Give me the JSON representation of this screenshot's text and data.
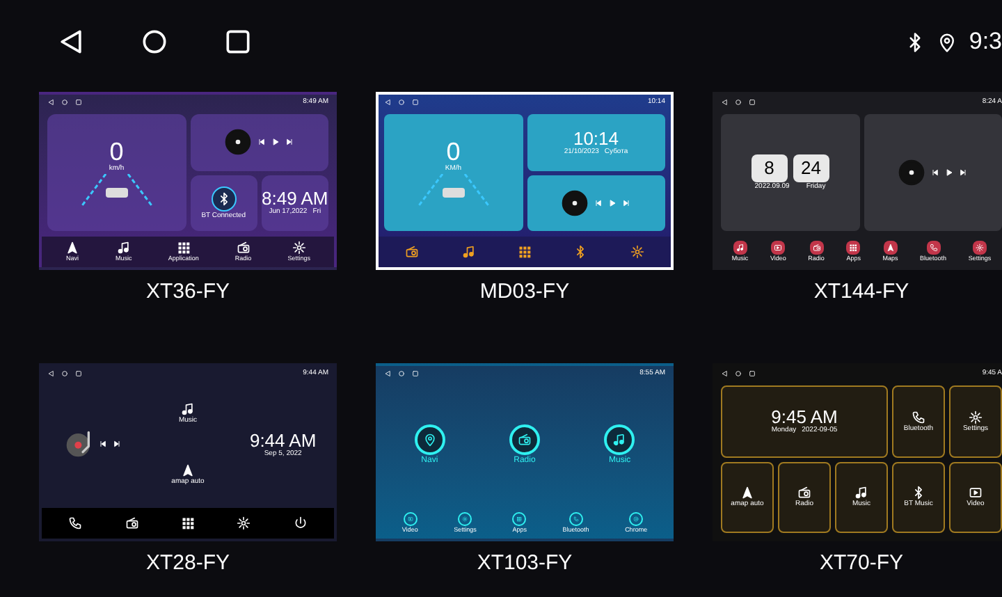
{
  "status_bar": {
    "time": "9:3"
  },
  "themes": [
    {
      "name": "XT36-FY",
      "selected": false,
      "status_time": "8:49 AM",
      "tiles": [
        {
          "kind": "speed",
          "texts": [
            "0",
            "km/h"
          ]
        },
        {
          "kind": "music"
        },
        {
          "kind": "bt",
          "texts": [
            "BT Connected"
          ]
        },
        {
          "kind": "clock",
          "texts": [
            "8:49 AM",
            "Jun 17,2022",
            "Fri"
          ]
        }
      ],
      "dock": [
        {
          "kind": "navigation",
          "label": "Navi"
        },
        {
          "kind": "music",
          "label": "Music"
        },
        {
          "kind": "apps",
          "label": "Application"
        },
        {
          "kind": "radio",
          "label": "Radio"
        },
        {
          "kind": "settings",
          "label": "Settings"
        }
      ]
    },
    {
      "name": "MD03-FY",
      "selected": true,
      "status_time": "10:14",
      "tiles": [
        {
          "kind": "speed",
          "texts": [
            "0",
            "KM/h"
          ]
        },
        {
          "kind": "clock",
          "texts": [
            "10:14",
            "21/10/2023",
            "Субота"
          ]
        },
        {
          "kind": "music"
        }
      ],
      "dock": [
        {
          "kind": "radio"
        },
        {
          "kind": "music"
        },
        {
          "kind": "apps"
        },
        {
          "kind": "bluetooth"
        },
        {
          "kind": "settings"
        }
      ]
    },
    {
      "name": "XT144-FY",
      "selected": false,
      "status_time": "8:24 A",
      "tiles": [
        {
          "kind": "flipclock",
          "texts": [
            "8",
            "24",
            "2022.09.09",
            "Friday"
          ]
        },
        {
          "kind": "music"
        }
      ],
      "dock": [
        {
          "kind": "music",
          "label": "Music"
        },
        {
          "kind": "video",
          "label": "Video"
        },
        {
          "kind": "radio",
          "label": "Radio"
        },
        {
          "kind": "apps",
          "label": "Apps"
        },
        {
          "kind": "navigation",
          "label": "Maps"
        },
        {
          "kind": "phone",
          "label": "Bluetooth"
        },
        {
          "kind": "settings",
          "label": "Settings"
        }
      ]
    },
    {
      "name": "XT28-FY",
      "selected": false,
      "status_time": "9:44 AM",
      "tiles": [
        {
          "kind": "player"
        },
        {
          "kind": "music_app",
          "texts": [
            "Music"
          ]
        },
        {
          "kind": "clock",
          "texts": [
            "9:44 AM",
            "Sep 5, 2022"
          ]
        },
        {
          "kind": "navigation_app",
          "texts": [
            "amap auto"
          ]
        }
      ],
      "dock": [
        {
          "kind": "phone"
        },
        {
          "kind": "radio"
        },
        {
          "kind": "apps"
        },
        {
          "kind": "settings"
        },
        {
          "kind": "power"
        }
      ]
    },
    {
      "name": "XT103-FY",
      "selected": false,
      "status_time": "8:55 AM",
      "tiles": [
        {
          "kind": "location_app",
          "texts": [
            "Navi"
          ]
        },
        {
          "kind": "radio_app",
          "texts": [
            "Radio"
          ]
        },
        {
          "kind": "music_app",
          "texts": [
            "Music"
          ]
        }
      ],
      "dock": [
        {
          "kind": "video",
          "label": "Video"
        },
        {
          "kind": "settings",
          "label": "Settings"
        },
        {
          "kind": "apps",
          "label": "Apps"
        },
        {
          "kind": "phone",
          "label": "Bluetooth"
        },
        {
          "kind": "browser",
          "label": "Chrome"
        }
      ]
    },
    {
      "name": "XT70-FY",
      "selected": false,
      "status_time": "9:45 A",
      "tiles": [
        {
          "kind": "clock",
          "texts": [
            "9:45 AM",
            "Monday",
            "2022-09-05"
          ]
        },
        {
          "kind": "phone_app",
          "texts": [
            "Bluetooth"
          ]
        },
        {
          "kind": "settings_app",
          "texts": [
            "Settings"
          ]
        },
        {
          "kind": "navigation_app",
          "texts": [
            "amap auto"
          ]
        },
        {
          "kind": "radio_app",
          "texts": [
            "Radio"
          ]
        },
        {
          "kind": "music_app",
          "texts": [
            "Music"
          ]
        },
        {
          "kind": "bluetooth_app",
          "texts": [
            "BT Music"
          ]
        },
        {
          "kind": "video_app",
          "texts": [
            "Video"
          ]
        }
      ]
    }
  ]
}
